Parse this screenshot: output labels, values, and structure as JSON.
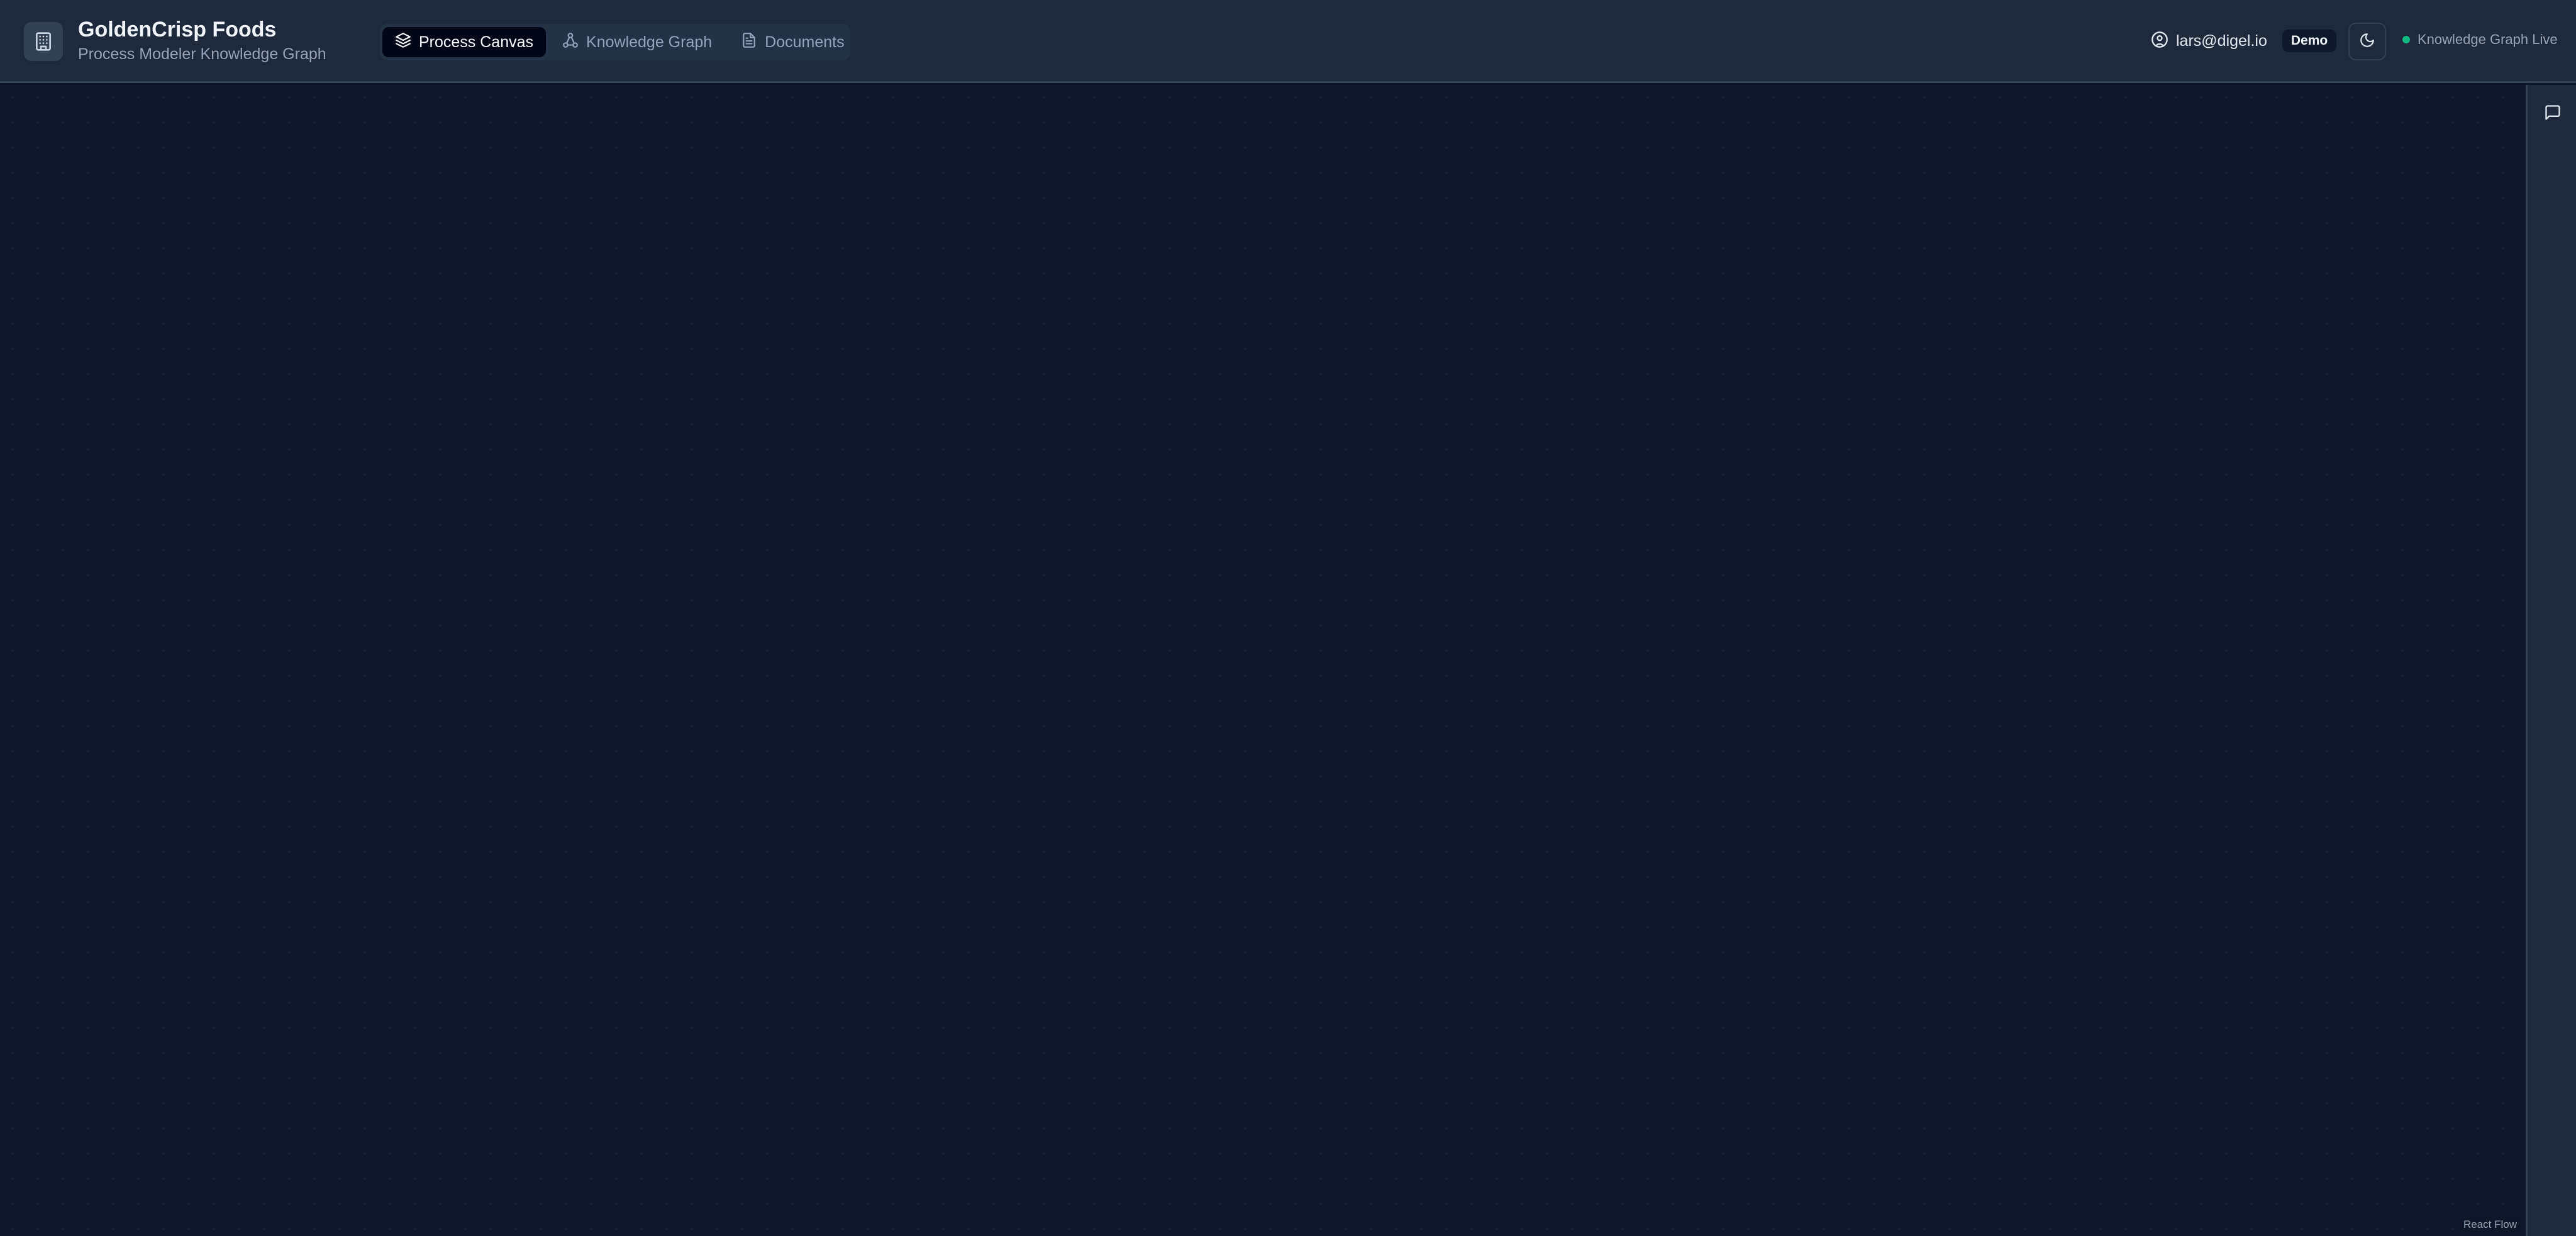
{
  "header": {
    "brand": {
      "title": "GoldenCrisp Foods",
      "subtitle": "Process Modeler Knowledge Graph",
      "logo_icon": "building-icon"
    },
    "tabs": [
      {
        "label": "Process Canvas",
        "icon": "layers-icon",
        "active": true
      },
      {
        "label": "Knowledge Graph",
        "icon": "graph-icon",
        "active": false
      },
      {
        "label": "Documents",
        "icon": "document-icon",
        "active": false
      }
    ],
    "user": {
      "email": "lars@digel.io",
      "badge": "Demo",
      "icon": "user-circle-icon"
    },
    "theme_toggle_icon": "moon-icon",
    "status": {
      "label": "Knowledge Graph Live",
      "color": "#10b981"
    }
  },
  "canvas": {
    "attribution": "React Flow"
  },
  "right_rail": {
    "chat_icon": "message-square-icon"
  },
  "colors": {
    "background": "#0f172a",
    "surface": "#1e293b",
    "active_tab": "#020617",
    "accent_status": "#10b981"
  }
}
